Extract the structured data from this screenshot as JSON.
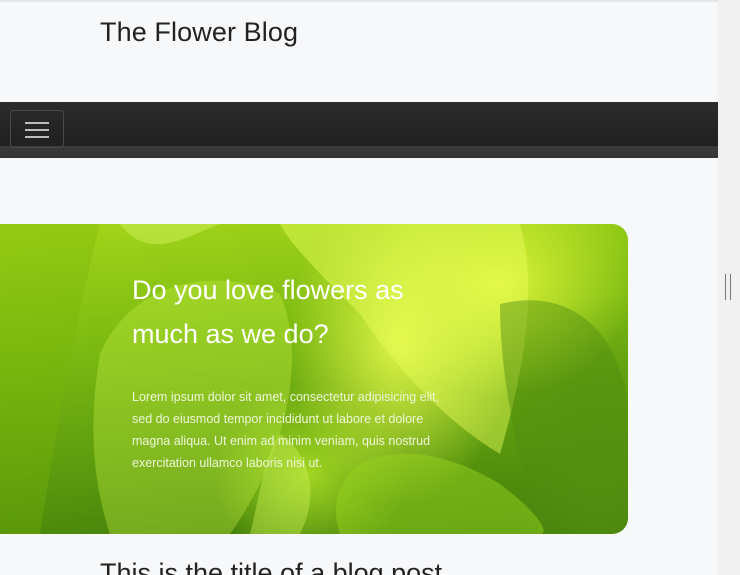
{
  "header": {
    "site_title": "The Flower Blog"
  },
  "navbar": {
    "toggle_icon": "hamburger-menu-icon"
  },
  "hero": {
    "heading": "Do you love flowers as much as we do?",
    "text": "Lorem ipsum dolor sit amet, consectetur adipisicing elit, sed do eiusmod tempor incididunt ut labore et dolore magna aliqua. Ut enim ad minim veniam, quis nostrud exercitation ullamco laboris nisi ut."
  },
  "post": {
    "title": "This is the title of a blog post"
  },
  "colors": {
    "navbar": "#202020",
    "page_background": "#f7f8fa",
    "hero_green": "#7dbb12"
  }
}
